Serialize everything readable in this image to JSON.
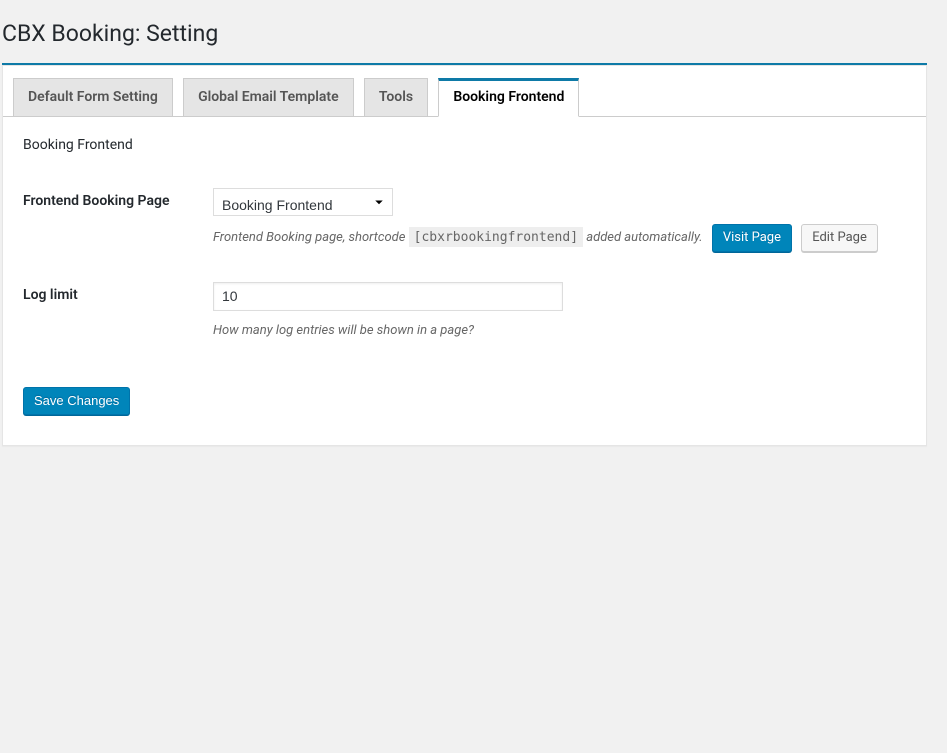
{
  "page": {
    "title": "CBX Booking: Setting"
  },
  "tabs": [
    {
      "label": "Default Form Setting",
      "active": false
    },
    {
      "label": "Global Email Template",
      "active": false
    },
    {
      "label": "Tools",
      "active": false
    },
    {
      "label": "Booking Frontend",
      "active": true
    }
  ],
  "section": {
    "title": "Booking Frontend"
  },
  "fields": {
    "frontend_page": {
      "label": "Frontend Booking Page",
      "selected": "Booking Frontend",
      "desc_before": "Frontend Booking page, shortcode ",
      "shortcode": "[cbxrbookingfrontend]",
      "desc_after": " added automatically. ",
      "visit_label": "Visit Page",
      "edit_label": "Edit Page"
    },
    "log_limit": {
      "label": "Log limit",
      "value": "10",
      "desc": "How many log entries will be shown in a page?"
    }
  },
  "submit": {
    "label": "Save Changes"
  }
}
